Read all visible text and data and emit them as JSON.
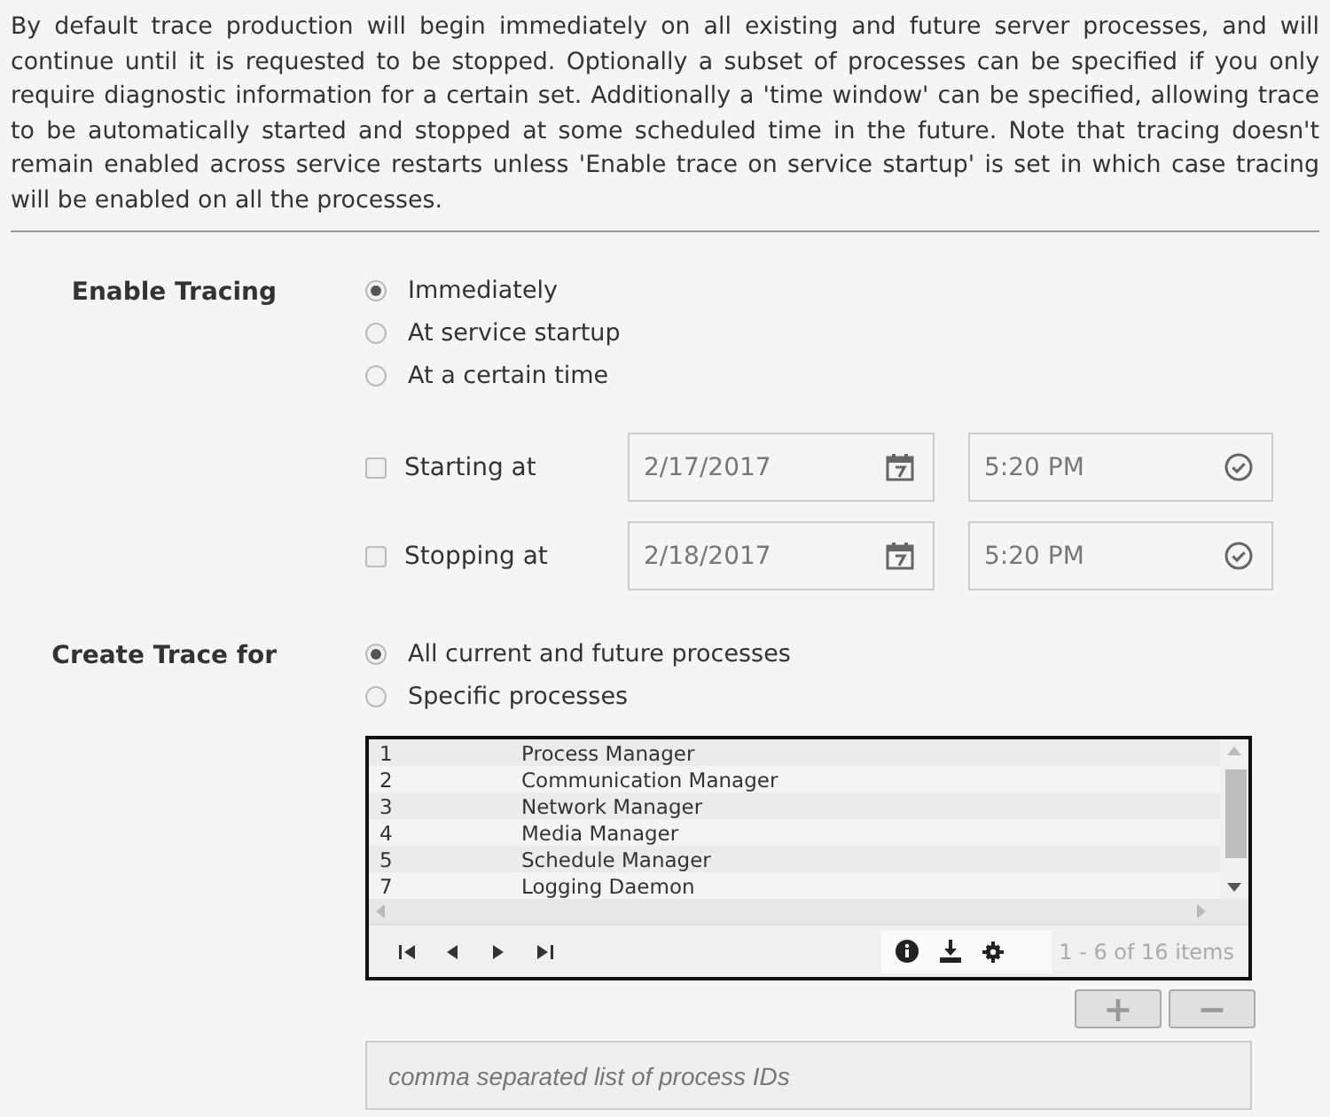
{
  "description": "By default trace production will begin immediately on all existing and future server processes, and will continue until it is requested to be stopped. Optionally a subset of processes can be specified if you only require diagnostic information for a certain set. Additionally a 'time window' can be specified, allowing trace to be automatically started and stopped at some scheduled time in the future. Note that tracing doesn't remain enabled across service restarts unless 'Enable trace on service startup' is set in which case tracing will be enabled on all the processes.",
  "enable_tracing": {
    "label": "Enable Tracing",
    "options": [
      {
        "label": "Immediately",
        "selected": true
      },
      {
        "label": "At service startup",
        "selected": false
      },
      {
        "label": "At a certain time",
        "selected": false
      }
    ],
    "schedule": [
      {
        "label": "Starting at",
        "checked": false,
        "date": "2/17/2017",
        "time": "5:20 PM"
      },
      {
        "label": "Stopping at",
        "checked": false,
        "date": "2/18/2017",
        "time": "5:20 PM"
      }
    ]
  },
  "create_trace": {
    "label": "Create Trace for",
    "options": [
      {
        "label": "All current and future processes",
        "selected": true
      },
      {
        "label": "Specific processes",
        "selected": false
      }
    ],
    "grid": {
      "rows": [
        {
          "id": "1",
          "name": "Process Manager"
        },
        {
          "id": "2",
          "name": "Communication Manager"
        },
        {
          "id": "3",
          "name": "Network Manager"
        },
        {
          "id": "4",
          "name": "Media Manager"
        },
        {
          "id": "5",
          "name": "Schedule Manager"
        },
        {
          "id": "7",
          "name": "Logging Daemon"
        }
      ],
      "pager_info": "1 - 6 of 16 items"
    },
    "buttons": [
      "+",
      "−"
    ],
    "ids_field": {
      "placeholder": "comma separated list of process IDs"
    }
  }
}
